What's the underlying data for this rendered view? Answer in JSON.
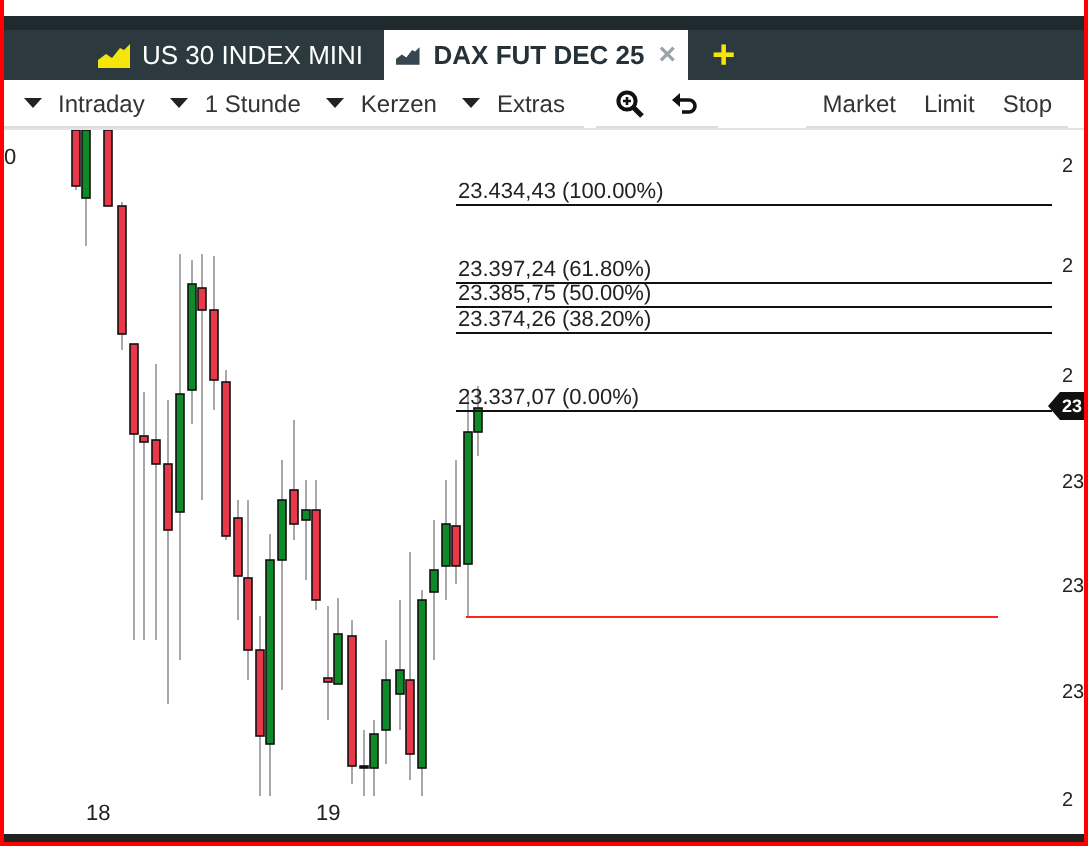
{
  "tabs": [
    {
      "label": "US 30 INDEX MINI",
      "selected": false
    },
    {
      "label": "DAX FUT DEC 25",
      "selected": true,
      "close": "×"
    }
  ],
  "add_tab": "+",
  "toolbar": {
    "dropdowns": [
      "Intraday",
      "1 Stunde",
      "Kerzen",
      "Extras"
    ],
    "orders": [
      "Market",
      "Limit",
      "Stop"
    ]
  },
  "chart": {
    "left_label": "0",
    "fib_levels": [
      {
        "label": "23.434,43 (100.00%)"
      },
      {
        "label": "23.397,24 (61.80%)"
      },
      {
        "label": "23.385,75 (50.00%)"
      },
      {
        "label": "23.374,26 (38.20%)"
      },
      {
        "label": "23.337,07 (0.00%)"
      }
    ],
    "price_marker": "23",
    "y_labels": [
      "2",
      "2",
      "2",
      "23",
      "23",
      "23",
      "2"
    ],
    "x_labels": [
      "18",
      "19"
    ]
  }
}
